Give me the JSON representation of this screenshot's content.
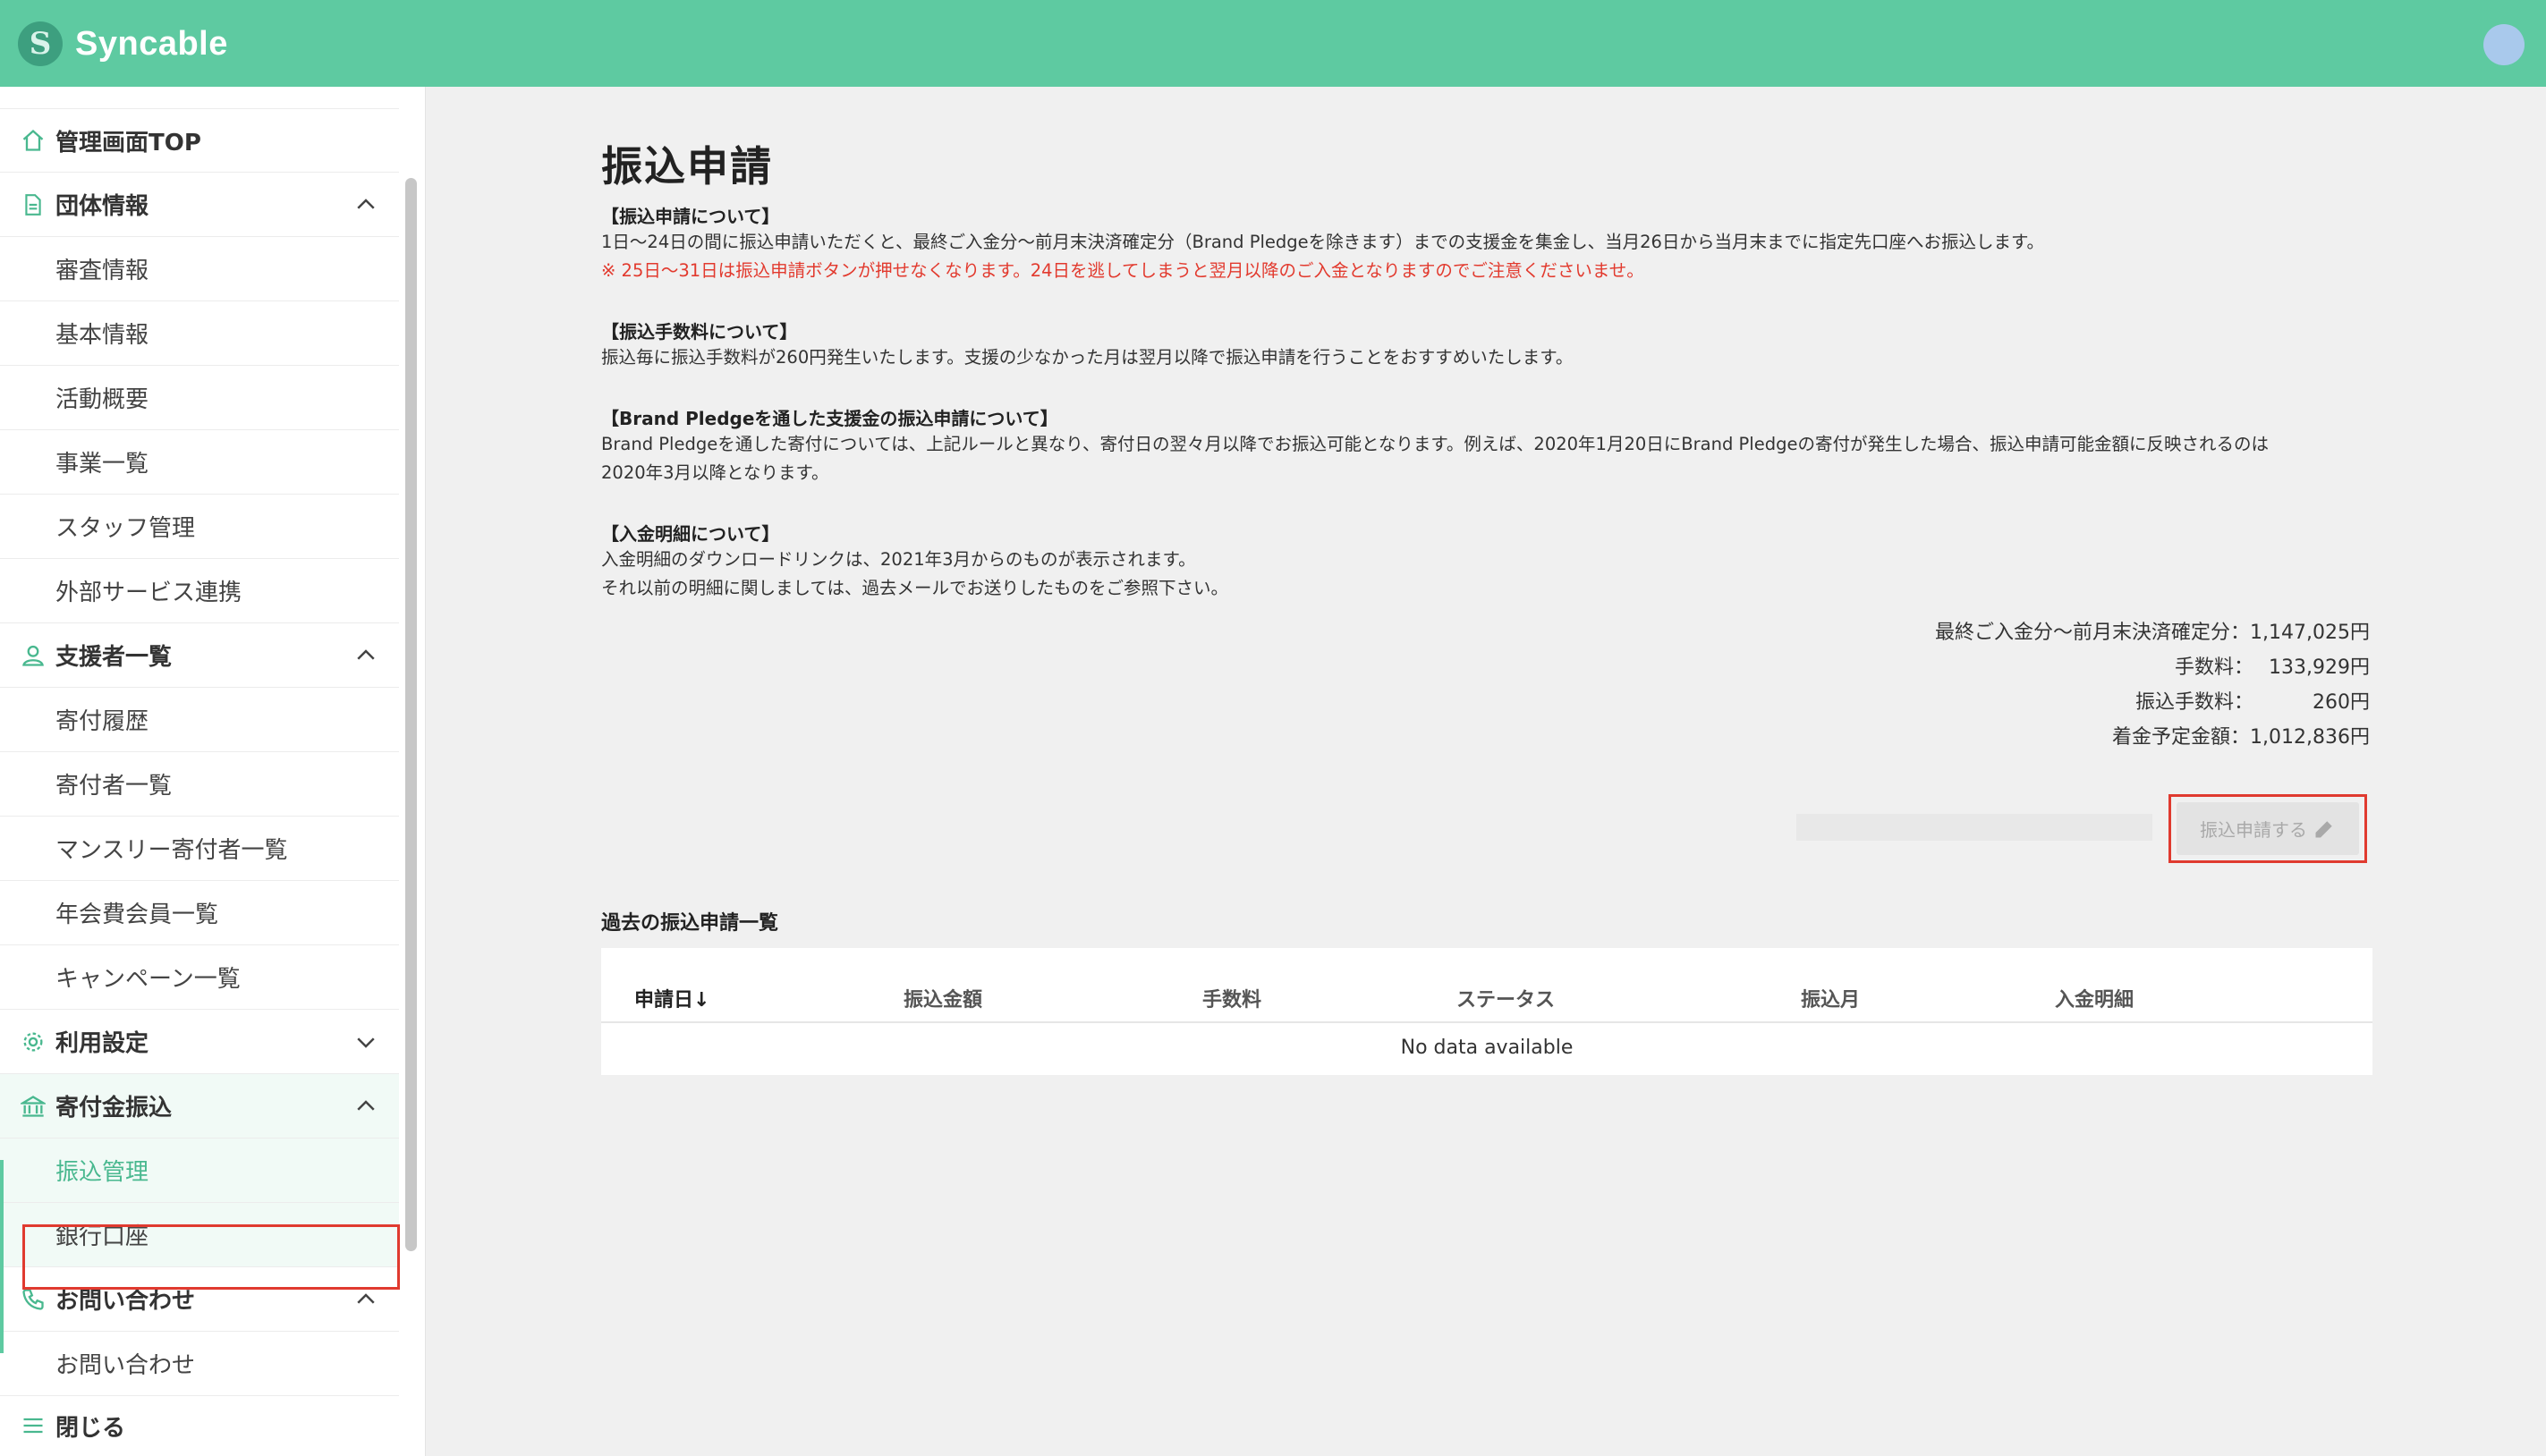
{
  "header": {
    "app_name": "Syncable",
    "logo_glyph": "S",
    "brand_color": "#5ecaa1"
  },
  "sidebar": {
    "items": [
      {
        "label": "管理画面TOP",
        "icon": "home-icon"
      },
      {
        "label": "団体情報",
        "icon": "document-icon",
        "expanded": true,
        "children": [
          "審査情報",
          "基本情報",
          "活動概要",
          "事業一覧",
          "スタッフ管理",
          "外部サービス連携"
        ]
      },
      {
        "label": "支援者一覧",
        "icon": "person-icon",
        "expanded": true,
        "children": [
          "寄付履歴",
          "寄付者一覧",
          "マンスリー寄付者一覧",
          "年会費会員一覧",
          "キャンペーン一覧"
        ]
      },
      {
        "label": "利用設定",
        "icon": "gear-icon",
        "expanded": false
      },
      {
        "label": "寄付金振込",
        "icon": "bank-icon",
        "expanded": true,
        "children": [
          "振込管理",
          "銀行口座"
        ],
        "current": "振込管理"
      },
      {
        "label": "お問い合わせ",
        "icon": "phone-icon",
        "expanded": true,
        "children": [
          "お問い合わせ"
        ]
      }
    ],
    "close_label": "閉じる"
  },
  "main": {
    "title": "振込申請",
    "sections": [
      {
        "heading": "【振込申請について】",
        "lines": [
          "1日〜24日の間に振込申請いただくと、最終ご入金分〜前月末決済確定分（Brand Pledgeを除きます）までの支援金を集金し、当月26日から当月末までに指定先口座へお振込します。"
        ],
        "warning": "※ 25日〜31日は振込申請ボタンが押せなくなります。24日を逃してしまうと翌月以降のご入金となりますのでご注意くださいませ。"
      },
      {
        "heading": "【振込手数料について】",
        "lines": [
          "振込毎に振込手数料が260円発生いたします。支援の少なかった月は翌月以降で振込申請を行うことをおすすめいたします。"
        ]
      },
      {
        "heading": "【Brand Pledgeを通した支援金の振込申請について】",
        "lines": [
          "Brand Pledgeを通した寄付については、上記ルールと異なり、寄付日の翌々月以降でお振込可能となります。例えば、2020年1月20日にBrand Pledgeの寄付が発生した場合、振込申請可能金額に反映されるのは",
          "2020年3月以降となります。"
        ]
      },
      {
        "heading": "【入金明細について】",
        "lines": [
          "入金明細のダウンロードリンクは、2021年3月からのものが表示されます。",
          "それ以前の明細に関しましては、過去メールでお送りしたものをご参照下さい。"
        ]
      }
    ],
    "summary": [
      {
        "label": "最終ご入金分〜前月末決済確定分：",
        "value": "1,147,025円"
      },
      {
        "label": "手数料：",
        "value": "133,929円"
      },
      {
        "label": "振込手数料：",
        "value": "260円"
      },
      {
        "label": "着金予定金額：",
        "value": "1,012,836円"
      }
    ],
    "apply_button": "振込申請する",
    "history_title": "過去の振込申請一覧",
    "table": {
      "columns": [
        "申請日↓",
        "振込金額",
        "手数料",
        "ステータス",
        "振込月",
        "入金明細"
      ],
      "empty_text": "No data available"
    }
  }
}
